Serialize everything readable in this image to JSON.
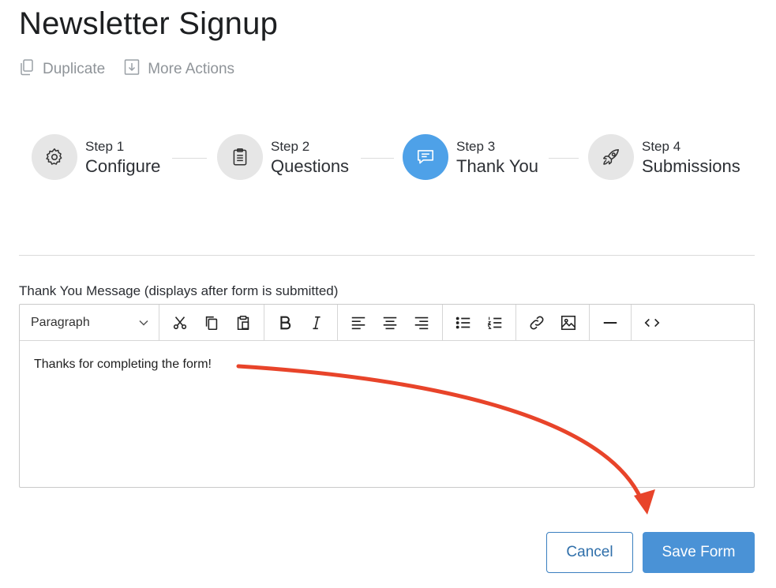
{
  "page": {
    "title": "Newsletter Signup"
  },
  "actions": {
    "duplicate_label": "Duplicate",
    "more_actions_label": "More Actions"
  },
  "steps": [
    {
      "num": "Step 1",
      "name": "Configure",
      "icon": "gear-icon",
      "active": false
    },
    {
      "num": "Step 2",
      "name": "Questions",
      "icon": "clipboard-icon",
      "active": false
    },
    {
      "num": "Step 3",
      "name": "Thank You",
      "icon": "chat-icon",
      "active": true
    },
    {
      "num": "Step 4",
      "name": "Submissions",
      "icon": "rocket-icon",
      "active": false
    }
  ],
  "editor": {
    "label": "Thank You Message (displays after form is submitted)",
    "format_select": "Paragraph",
    "toolbar_icons": [
      "cut-icon",
      "copy-icon",
      "paste-icon",
      "bold-icon",
      "italic-icon",
      "align-left-icon",
      "align-center-icon",
      "align-right-icon",
      "bullet-list-icon",
      "numbered-list-icon",
      "link-icon",
      "image-icon",
      "horizontal-rule-icon",
      "code-icon"
    ],
    "content": "Thanks for completing the form!"
  },
  "footer": {
    "cancel_label": "Cancel",
    "save_label": "Save Form"
  },
  "colors": {
    "active_step": "#4ea1e8",
    "primary_button": "#4a92d6",
    "annotation_arrow": "#e8442a"
  }
}
